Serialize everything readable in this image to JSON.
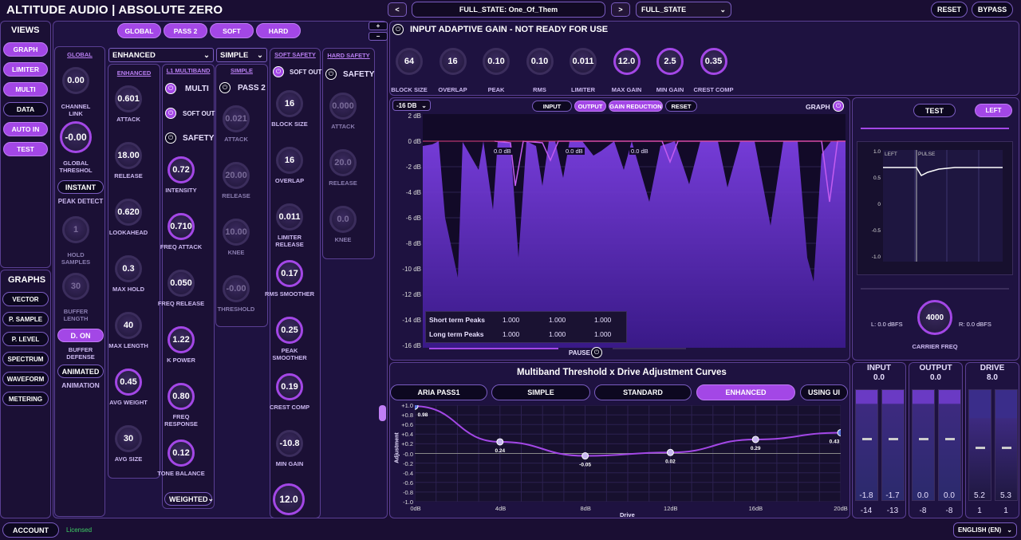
{
  "app": {
    "title": "ALTITUDE AUDIO | ABSOLUTE ZERO"
  },
  "topbar": {
    "prev": "<",
    "next": ">",
    "preset_name": "FULL_STATE: One_Of_Them",
    "state_select": "FULL_STATE",
    "reset": "RESET",
    "bypass": "BYPASS"
  },
  "views": {
    "title": "VIEWS",
    "items": [
      "GRAPH",
      "LIMITER",
      "MULTI",
      "DATA",
      "AUTO IN",
      "TEST"
    ]
  },
  "graphs": {
    "title": "GRAPHS",
    "items": [
      "VECTOR",
      "P. SAMPLE",
      "P. LEVEL",
      "SPECTRUM",
      "WAVEFORM",
      "METERING"
    ]
  },
  "modes": [
    "GLOBAL",
    "PASS 2",
    "SOFT",
    "HARD"
  ],
  "plus": "+",
  "minus": "−",
  "global_col": {
    "title": "GLOBAL",
    "channel_link": {
      "value": "0.00",
      "label": "CHANNEL LINK"
    },
    "global_thresh": {
      "value": "-0.00",
      "label": "GLOBAL THRESHOL"
    },
    "instant": "INSTANT",
    "peak_detect": "PEAK DETECT",
    "hold_samples": {
      "value": "1",
      "label": "HOLD SAMPLES"
    },
    "buffer_length": {
      "value": "30",
      "label": "BUFFER LENGTH"
    },
    "d_on": "D. ON",
    "buffer_defense": "BUFFER DEFENSE",
    "animated": "ANIMATED",
    "animation": "ANIMATION"
  },
  "enhanced_col": {
    "select": "ENHANCED",
    "title": "ENHANCED",
    "attack": {
      "value": "0.601",
      "label": "ATTACK"
    },
    "release": {
      "value": "18.00",
      "label": "RELEASE"
    },
    "lookahead": {
      "value": "0.620",
      "label": "LOOKAHEAD"
    },
    "max_hold": {
      "value": "0.3",
      "label": "MAX HOLD"
    },
    "max_length": {
      "value": "40",
      "label": "MAX LENGTH"
    },
    "avg_weight": {
      "value": "0.45",
      "label": "AVG WEIGHT"
    },
    "avg_size": {
      "value": "30",
      "label": "AVG SIZE"
    }
  },
  "l1_col": {
    "title": "L1 MULTIBAND",
    "multi": "MULTI",
    "soft_out": "SOFT OUT",
    "safety": "SAFETY",
    "intensity": {
      "value": "0.72",
      "label": "INTENSITY"
    },
    "freq_attack": {
      "value": "0.710",
      "label": "FREQ ATTACK"
    },
    "freq_release": {
      "value": "0.050",
      "label": "FREQ RELEASE"
    },
    "k_power": {
      "value": "1.22",
      "label": "K POWER"
    },
    "freq_response": {
      "value": "0.80",
      "label": "FREQ RESPONSE"
    },
    "tone_balance": {
      "value": "0.12",
      "label": "TONE BALANCE"
    },
    "weighted": "WEIGHTED"
  },
  "simple_col": {
    "select": "SIMPLE",
    "title": "SIMPLE",
    "pass2": "PASS 2",
    "attack": {
      "value": "0.021",
      "label": "ATTACK"
    },
    "release": {
      "value": "20.00",
      "label": "RELEASE"
    },
    "knee": {
      "value": "10.00",
      "label": "KNEE"
    },
    "threshold": {
      "value": "-0.00",
      "label": "THRESHOLD"
    }
  },
  "soft_col": {
    "title": "SOFT SAFETY",
    "soft_out": "SOFT OUT",
    "block_size": {
      "value": "16",
      "label": "BLOCK SIZE"
    },
    "overlap": {
      "value": "16",
      "label": "OVERLAP"
    },
    "limiter_release": {
      "value": "0.011",
      "label": "LIMITER RELEASE"
    },
    "rms_smoother": {
      "value": "0.17",
      "label": "RMS SMOOTHER"
    },
    "peak_smoother": {
      "value": "0.25",
      "label": "PEAK SMOOTHER"
    },
    "crest_comp": {
      "value": "0.19",
      "label": "CREST COMP"
    },
    "min_gain": {
      "value": "-10.8",
      "label": "MIN GAIN"
    },
    "bottom": {
      "value": "12.0"
    }
  },
  "hard_col": {
    "title": "HARD SAFETY",
    "safety": "SAFETY",
    "attack": {
      "value": "0.000",
      "label": "ATTACK"
    },
    "release": {
      "value": "20.0",
      "label": "RELEASE"
    },
    "knee": {
      "value": "0.0",
      "label": "KNEE"
    }
  },
  "adaptive": {
    "title": "INPUT ADAPTIVE GAIN - NOT READY FOR USE",
    "knobs": [
      {
        "value": "64",
        "label": "BLOCK SIZE"
      },
      {
        "value": "16",
        "label": "OVERLAP"
      },
      {
        "value": "0.10",
        "label": "PEAK SMOOTHER"
      },
      {
        "value": "0.10",
        "label": "RMS SMOOTHER"
      },
      {
        "value": "0.011",
        "label": "LIMITER RELEASE"
      },
      {
        "value": "12.0",
        "label": "MAX GAIN"
      },
      {
        "value": "2.5",
        "label": "MIN GAIN"
      },
      {
        "value": "0.35",
        "label": "CREST COMP"
      }
    ]
  },
  "graph": {
    "range": "-16 DB",
    "input": "INPUT",
    "output": "OUTPUT",
    "gain_reduction": "GAIN REDUCTION",
    "reset": "RESET",
    "label": "GRAPH",
    "yticks": [
      "2 dB",
      "0 dB",
      "-2 dB",
      "-4 dB",
      "-6 dB",
      "-8 dB",
      "-10 dB",
      "-12 dB",
      "-14 dB",
      "-16 dB"
    ],
    "markers": [
      "0.0 dB",
      "0.0 dB",
      "0.0 dB"
    ],
    "short_term": {
      "label": "Short term Peaks",
      "values": [
        "1.000",
        "1.000",
        "1.000"
      ]
    },
    "long_term": {
      "label": "Long term Peaks",
      "values": [
        "1.000",
        "1.000",
        "1.000"
      ]
    },
    "pause": "PAUSE"
  },
  "vector": {
    "test": "TEST",
    "left": "LEFT",
    "left_tag": "LEFT",
    "pulse_tag": "PULSE",
    "yticks": [
      "1.0",
      "0.5",
      "0",
      "-0.5",
      "-1.0"
    ],
    "l_val": "L: 0.0 dBFS",
    "r_val": "R: 0.0 dBFS",
    "carrier": {
      "value": "4000",
      "label": "CARRIER FREQ"
    }
  },
  "curves": {
    "title": "Multiband Threshold x Drive Adjustment Curves",
    "tabs": [
      "ARIA PASS1",
      "SIMPLE",
      "STANDARD",
      "ENHANCED",
      "USING UI"
    ],
    "ylabel": "Adjustment",
    "xlabel": "Drive",
    "yticks": [
      "+1.0",
      "+0.8",
      "+0.6",
      "+0.4",
      "+0.2",
      "-0.0",
      "-0.2",
      "-0.4",
      "-0.6",
      "-0.8",
      "-1.0"
    ],
    "xticks": [
      "0dB",
      "4dB",
      "8dB",
      "12dB",
      "16dB",
      "20dB"
    ],
    "points": [
      {
        "x": 0,
        "y": 0.98,
        "label": "0.98"
      },
      {
        "x": 4,
        "y": 0.24,
        "label": "0.24"
      },
      {
        "x": 8,
        "y": -0.05,
        "label": "-0.05"
      },
      {
        "x": 12,
        "y": 0.02,
        "label": "0.02"
      },
      {
        "x": 16,
        "y": 0.29,
        "label": "0.29"
      },
      {
        "x": 20,
        "y": 0.43,
        "label": "0.43"
      }
    ]
  },
  "meters": {
    "input": {
      "title": "INPUT",
      "value": "0.0",
      "l": "-1.8",
      "r": "-1.7",
      "lo": "-14",
      "ro": "-13"
    },
    "output": {
      "title": "OUTPUT",
      "value": "0.0",
      "l": "0.0",
      "r": "0.0",
      "lo": "-8",
      "ro": "-8"
    },
    "drive": {
      "title": "DRIVE",
      "value": "8.0",
      "l": "5.2",
      "r": "5.3",
      "lo": "1",
      "ro": "1"
    }
  },
  "footer": {
    "account": "ACCOUNT",
    "licensed": "Licensed",
    "language": "ENGLISH (EN)"
  }
}
